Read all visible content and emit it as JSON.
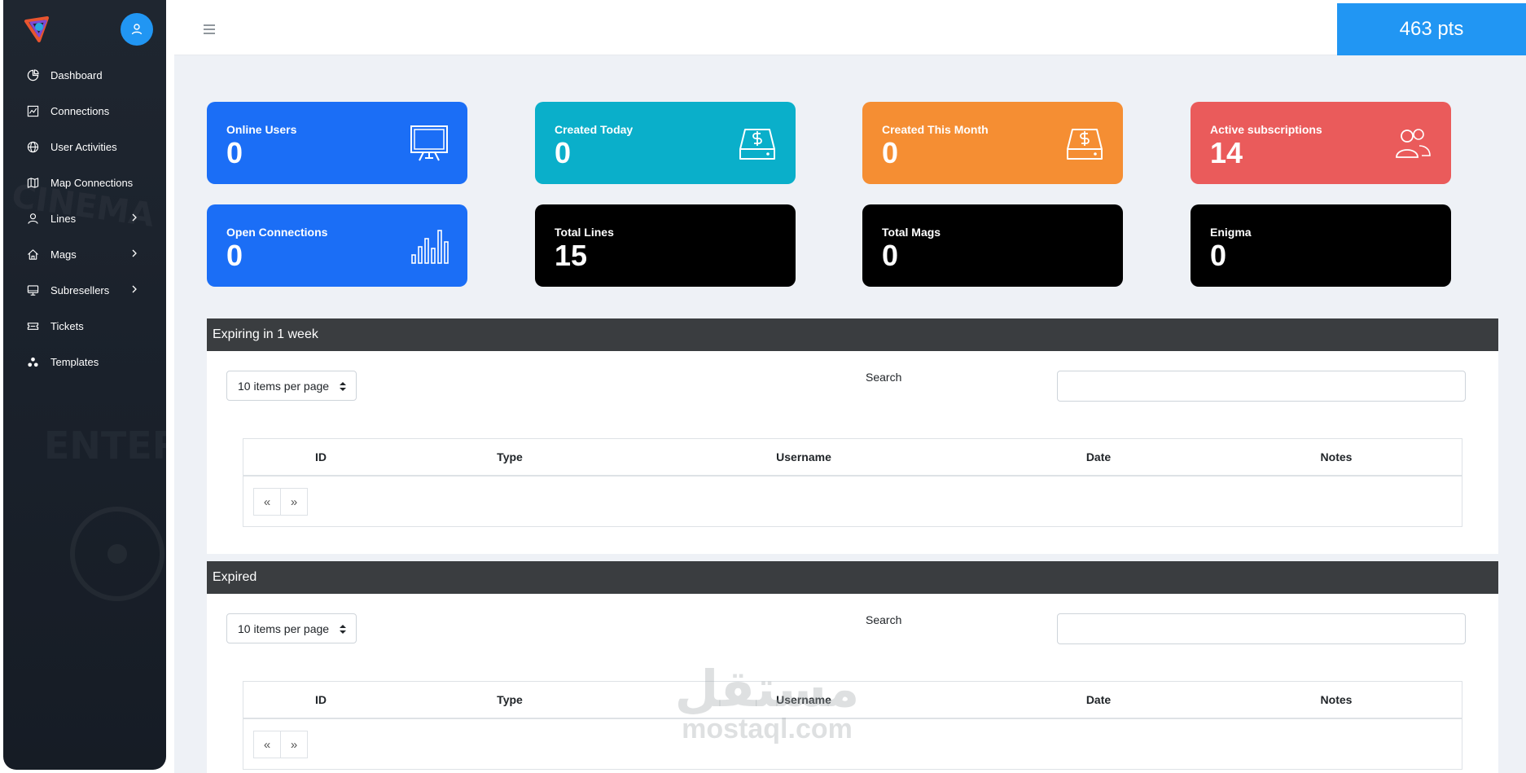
{
  "sidebar": {
    "items": [
      {
        "label": "Dashboard",
        "icon": "pie-chart-icon",
        "has_submenu": false
      },
      {
        "label": "Connections",
        "icon": "line-chart-icon",
        "has_submenu": false
      },
      {
        "label": "User Activities",
        "icon": "globe-icon",
        "has_submenu": false
      },
      {
        "label": "Map Connections",
        "icon": "map-icon",
        "has_submenu": false
      },
      {
        "label": "Lines",
        "icon": "user-icon",
        "has_submenu": true
      },
      {
        "label": "Mags",
        "icon": "home-icon",
        "has_submenu": true
      },
      {
        "label": "Subresellers",
        "icon": "monitor-icon",
        "has_submenu": true
      },
      {
        "label": "Tickets",
        "icon": "ticket-icon",
        "has_submenu": false
      },
      {
        "label": "Templates",
        "icon": "templates-icon",
        "has_submenu": false
      }
    ]
  },
  "header": {
    "points": "463 pts"
  },
  "cards": [
    {
      "label": "Online Users",
      "value": "0",
      "icon": "monitor-icon",
      "color": "#1b6ef6"
    },
    {
      "label": "Created Today",
      "value": "0",
      "icon": "money-drive-icon",
      "color": "#0aafca"
    },
    {
      "label": "Created This Month",
      "value": "0",
      "icon": "money-drive-icon",
      "color": "#f58e33"
    },
    {
      "label": "Active subscriptions",
      "value": "14",
      "icon": "users-icon",
      "color": "#ea5b5b"
    },
    {
      "label": "Open Connections",
      "value": "0",
      "icon": "bar-chart-icon",
      "color": "#1b6ef6"
    },
    {
      "label": "Total Lines",
      "value": "15",
      "icon": "",
      "color": "#000000"
    },
    {
      "label": "Total Mags",
      "value": "0",
      "icon": "",
      "color": "#000000"
    },
    {
      "label": "Enigma",
      "value": "0",
      "icon": "",
      "color": "#000000"
    }
  ],
  "panels": [
    {
      "title": "Expiring in 1 week",
      "per_page": "10 items per page",
      "search_label": "Search",
      "columns": [
        "ID",
        "Type",
        "Username",
        "Date",
        "Notes"
      ],
      "pager": [
        "«",
        "»"
      ]
    },
    {
      "title": "Expired",
      "per_page": "10 items per page",
      "search_label": "Search",
      "columns": [
        "ID",
        "Type",
        "Username",
        "Date",
        "Notes"
      ],
      "pager": [
        "«",
        "»"
      ]
    }
  ],
  "watermark": {
    "arabic": "مستقل",
    "latin": "mostaql.com"
  }
}
